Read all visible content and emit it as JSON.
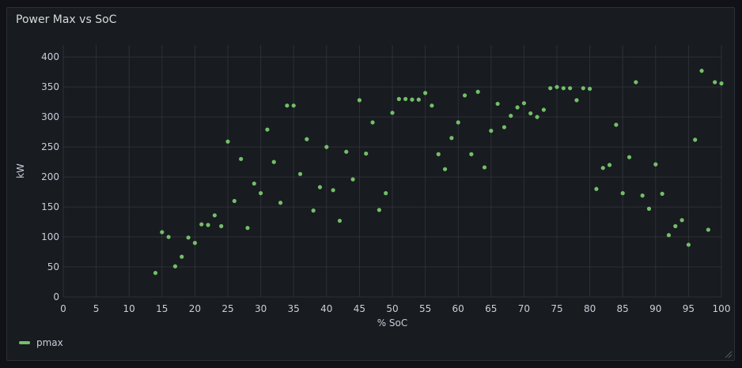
{
  "panel": {
    "title": "Power Max vs SoC"
  },
  "legend": {
    "label": "pmax"
  },
  "colors": {
    "series": "#73bf69",
    "grid": "#2c3038",
    "text": "#ccccdc",
    "background": "#181b1f"
  },
  "chart_data": {
    "type": "scatter",
    "title": "Power Max vs SoC",
    "xlabel": "% SoC",
    "ylabel": "kW",
    "xlim": [
      0,
      100
    ],
    "ylim": [
      0,
      420
    ],
    "xticks": [
      0,
      5,
      10,
      15,
      20,
      25,
      30,
      35,
      40,
      45,
      50,
      55,
      60,
      65,
      70,
      75,
      80,
      85,
      90,
      95,
      100
    ],
    "yticks": [
      0,
      50,
      100,
      150,
      200,
      250,
      300,
      350,
      400
    ],
    "grid": true,
    "legend_position": "bottom-left",
    "series": [
      {
        "name": "pmax",
        "points": [
          [
            14,
            40
          ],
          [
            15,
            108
          ],
          [
            16,
            100
          ],
          [
            17,
            51
          ],
          [
            18,
            67
          ],
          [
            19,
            99
          ],
          [
            20,
            90
          ],
          [
            21,
            121
          ],
          [
            22,
            120
          ],
          [
            23,
            136
          ],
          [
            24,
            118
          ],
          [
            25,
            259
          ],
          [
            26,
            160
          ],
          [
            27,
            230
          ],
          [
            28,
            115
          ],
          [
            29,
            189
          ],
          [
            30,
            173
          ],
          [
            31,
            279
          ],
          [
            32,
            225
          ],
          [
            33,
            157
          ],
          [
            34,
            319
          ],
          [
            35,
            319
          ],
          [
            36,
            205
          ],
          [
            37,
            263
          ],
          [
            38,
            144
          ],
          [
            39,
            183
          ],
          [
            40,
            250
          ],
          [
            41,
            178
          ],
          [
            42,
            127
          ],
          [
            43,
            242
          ],
          [
            44,
            196
          ],
          [
            45,
            328
          ],
          [
            46,
            239
          ],
          [
            47,
            291
          ],
          [
            48,
            145
          ],
          [
            49,
            173
          ],
          [
            50,
            307
          ],
          [
            51,
            330
          ],
          [
            52,
            330
          ],
          [
            53,
            329
          ],
          [
            54,
            329
          ],
          [
            55,
            340
          ],
          [
            56,
            319
          ],
          [
            57,
            238
          ],
          [
            58,
            213
          ],
          [
            59,
            265
          ],
          [
            60,
            291
          ],
          [
            61,
            336
          ],
          [
            62,
            238
          ],
          [
            63,
            342
          ],
          [
            64,
            216
          ],
          [
            65,
            277
          ],
          [
            66,
            322
          ],
          [
            67,
            283
          ],
          [
            68,
            302
          ],
          [
            69,
            316
          ],
          [
            70,
            323
          ],
          [
            71,
            306
          ],
          [
            72,
            300
          ],
          [
            73,
            312
          ],
          [
            74,
            348
          ],
          [
            75,
            350
          ],
          [
            76,
            348
          ],
          [
            77,
            348
          ],
          [
            78,
            328
          ],
          [
            79,
            348
          ],
          [
            80,
            347
          ],
          [
            81,
            180
          ],
          [
            82,
            215
          ],
          [
            83,
            220
          ],
          [
            84,
            287
          ],
          [
            85,
            173
          ],
          [
            86,
            233
          ],
          [
            87,
            358
          ],
          [
            88,
            169
          ],
          [
            89,
            147
          ],
          [
            90,
            221
          ],
          [
            91,
            172
          ],
          [
            92,
            103
          ],
          [
            93,
            118
          ],
          [
            94,
            128
          ],
          [
            95,
            87
          ],
          [
            96,
            262
          ],
          [
            97,
            377
          ],
          [
            98,
            112
          ],
          [
            99,
            358
          ],
          [
            100,
            356
          ]
        ]
      }
    ]
  }
}
